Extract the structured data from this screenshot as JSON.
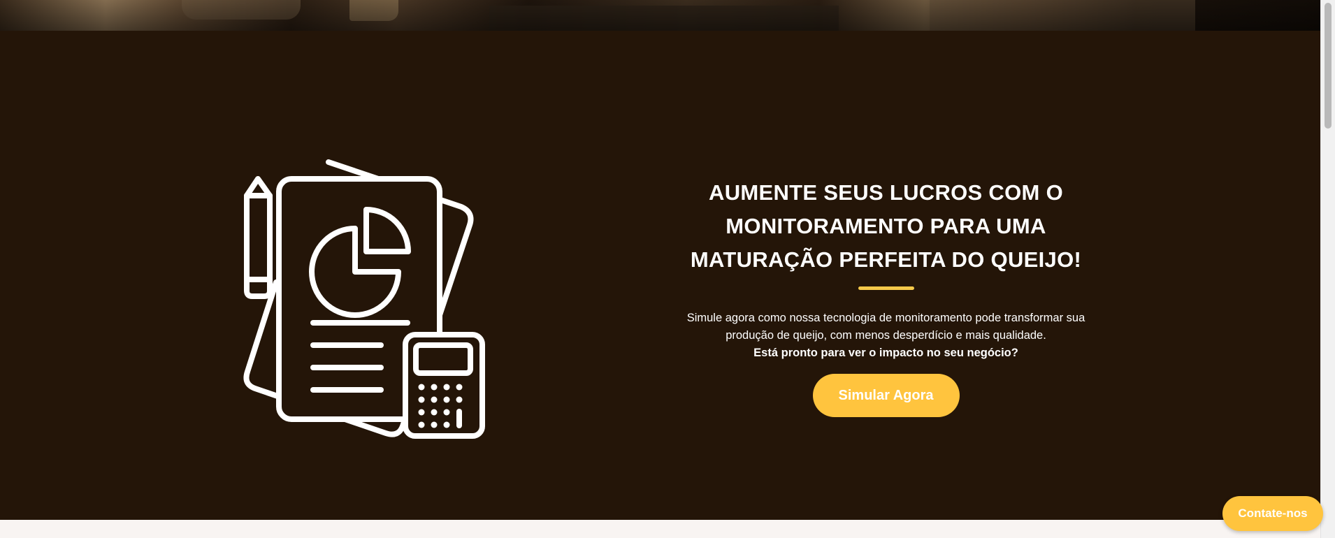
{
  "hero": {
    "background": "cheese-cellar-photo"
  },
  "section": {
    "background_color": "#241508",
    "illustration_icon": "report-chart-calculator-icon",
    "headline": "AUMENTE SEUS LUCROS COM O MONITORAMENTO PARA UMA MATURAÇÃO PERFEITA DO QUEIJO!",
    "accent_color": "#f6c94a",
    "description": "Simule agora como nossa tecnologia de monitoramento pode transformar sua produção de queijo, com menos desperdício e mais qualidade.",
    "question": "Está pronto para ver o impacto no seu negócio?",
    "cta_label": "Simular Agora",
    "cta_color": "#ffc43e"
  },
  "floating": {
    "contact_label": "Contate-nos"
  }
}
